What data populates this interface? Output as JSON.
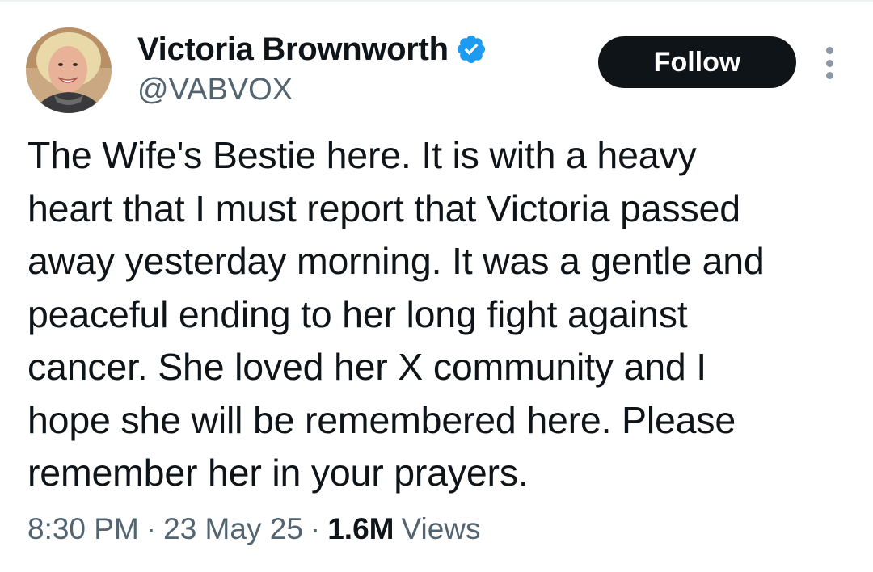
{
  "author": {
    "display_name": "Victoria Brownworth",
    "handle": "@VABVOX",
    "verified": true,
    "avatar_icon": "profile-photo"
  },
  "actions": {
    "follow_label": "Follow",
    "more_icon": "vertical-ellipsis-icon"
  },
  "tweet": {
    "lines": [
      "The Wife's Bestie here. It is with a heavy",
      "heart that I must report that Victoria passed",
      "away yesterday morning. It was a gentle and",
      "peaceful ending to her long fight against",
      "cancer. She loved her X community and I",
      "hope she will be remembered here. Please",
      "remember her in your prayers."
    ]
  },
  "meta": {
    "time": "8:30 PM",
    "separator": "·",
    "date": "23 May 25",
    "views_count": "1.6M",
    "views_label": "Views"
  },
  "colors": {
    "text_primary": "#0f1419",
    "text_secondary": "#536471",
    "verified_blue": "#1d9bf0",
    "follow_bg": "#0f1419"
  }
}
